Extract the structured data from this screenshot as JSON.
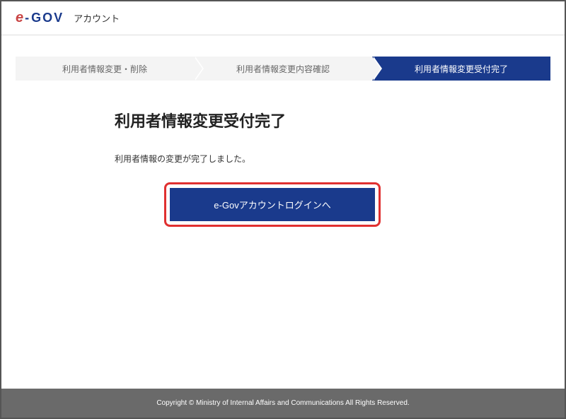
{
  "header": {
    "logo_e": "e",
    "logo_dash": "-",
    "logo_gov": "GOV",
    "logo_sub": "アカウント"
  },
  "steps": {
    "step1": "利用者情報変更・削除",
    "step2": "利用者情報変更内容確認",
    "step3": "利用者情報変更受付完了"
  },
  "main": {
    "title": "利用者情報変更受付完了",
    "message": "利用者情報の変更が完了しました。",
    "button_label": "e-Govアカウントログインへ"
  },
  "footer": {
    "copyright": "Copyright © Ministry of Internal Affairs and Communications All Rights Reserved."
  }
}
